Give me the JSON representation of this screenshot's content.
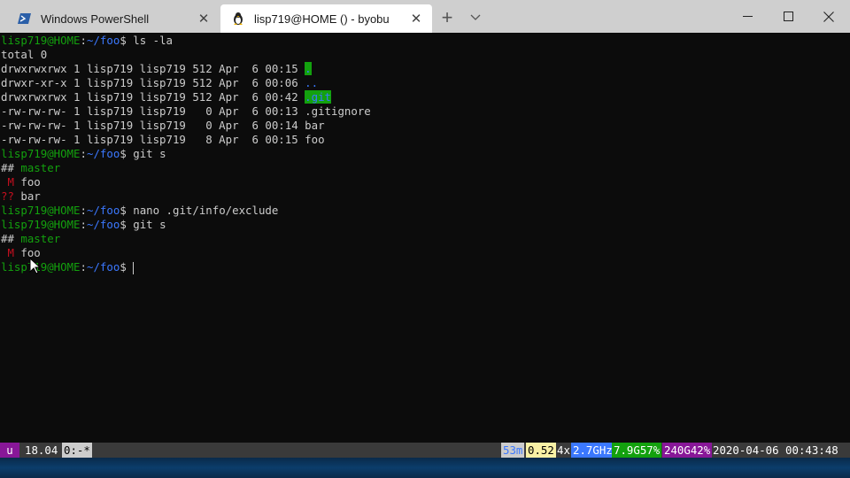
{
  "tabs": [
    {
      "label": "Windows PowerShell",
      "icon": "powershell-icon",
      "close": "✕"
    },
    {
      "label": "lisp719@HOME () - byobu",
      "icon": "linux-penguin-icon",
      "close": "✕"
    }
  ],
  "newtab_label": "+",
  "window_controls": {
    "minimize": "—",
    "maximize": "☐",
    "close": "✕"
  },
  "terminal": {
    "prompt_user": "lisp719@HOME",
    "prompt_sep": ":",
    "prompt_tilde": "~/",
    "prompt_dir": "foo",
    "prompt_dollar": "$ ",
    "cmd1": "ls -la",
    "total": "total 0",
    "listing": [
      {
        "meta": "drwxrwxrwx 1 lisp719 lisp719 512 Apr  6 00:15 ",
        "name": "."
      },
      {
        "meta": "drwxr-xr-x 1 lisp719 lisp719 512 Apr  6 00:06 ",
        "name": ".."
      },
      {
        "meta": "drwxrwxrwx 1 lisp719 lisp719 512 Apr  6 00:42 ",
        "name": ".git"
      },
      {
        "meta": "-rw-rw-rw- 1 lisp719 lisp719   0 Apr  6 00:13 ",
        "name": ".gitignore"
      },
      {
        "meta": "-rw-rw-rw- 1 lisp719 lisp719   0 Apr  6 00:14 ",
        "name": "bar"
      },
      {
        "meta": "-rw-rw-rw- 1 lisp719 lisp719   8 Apr  6 00:15 ",
        "name": "foo"
      }
    ],
    "cmd2": "git s",
    "hashes": "## ",
    "branch": "master",
    "status_m": " M",
    "status_q": "??",
    "file_foo": " foo",
    "file_bar": " bar",
    "cmd3": "nano .git/info/exclude",
    "cmd4": "git s"
  },
  "statusbar": {
    "u": "u",
    "version": "18.04",
    "window": "0:-*",
    "mem": "53m",
    "load": "0.52",
    "cpu_count": "4x",
    "cpu_freq": "2.7GHz",
    "mem_info": "7.9G57%",
    "disk": "240G42%",
    "datetime": "2020-04-06 00:43:48"
  },
  "colors": {
    "accent_green": "#13a10e",
    "accent_blue": "#3b78ff",
    "status_purple": "#881798"
  }
}
